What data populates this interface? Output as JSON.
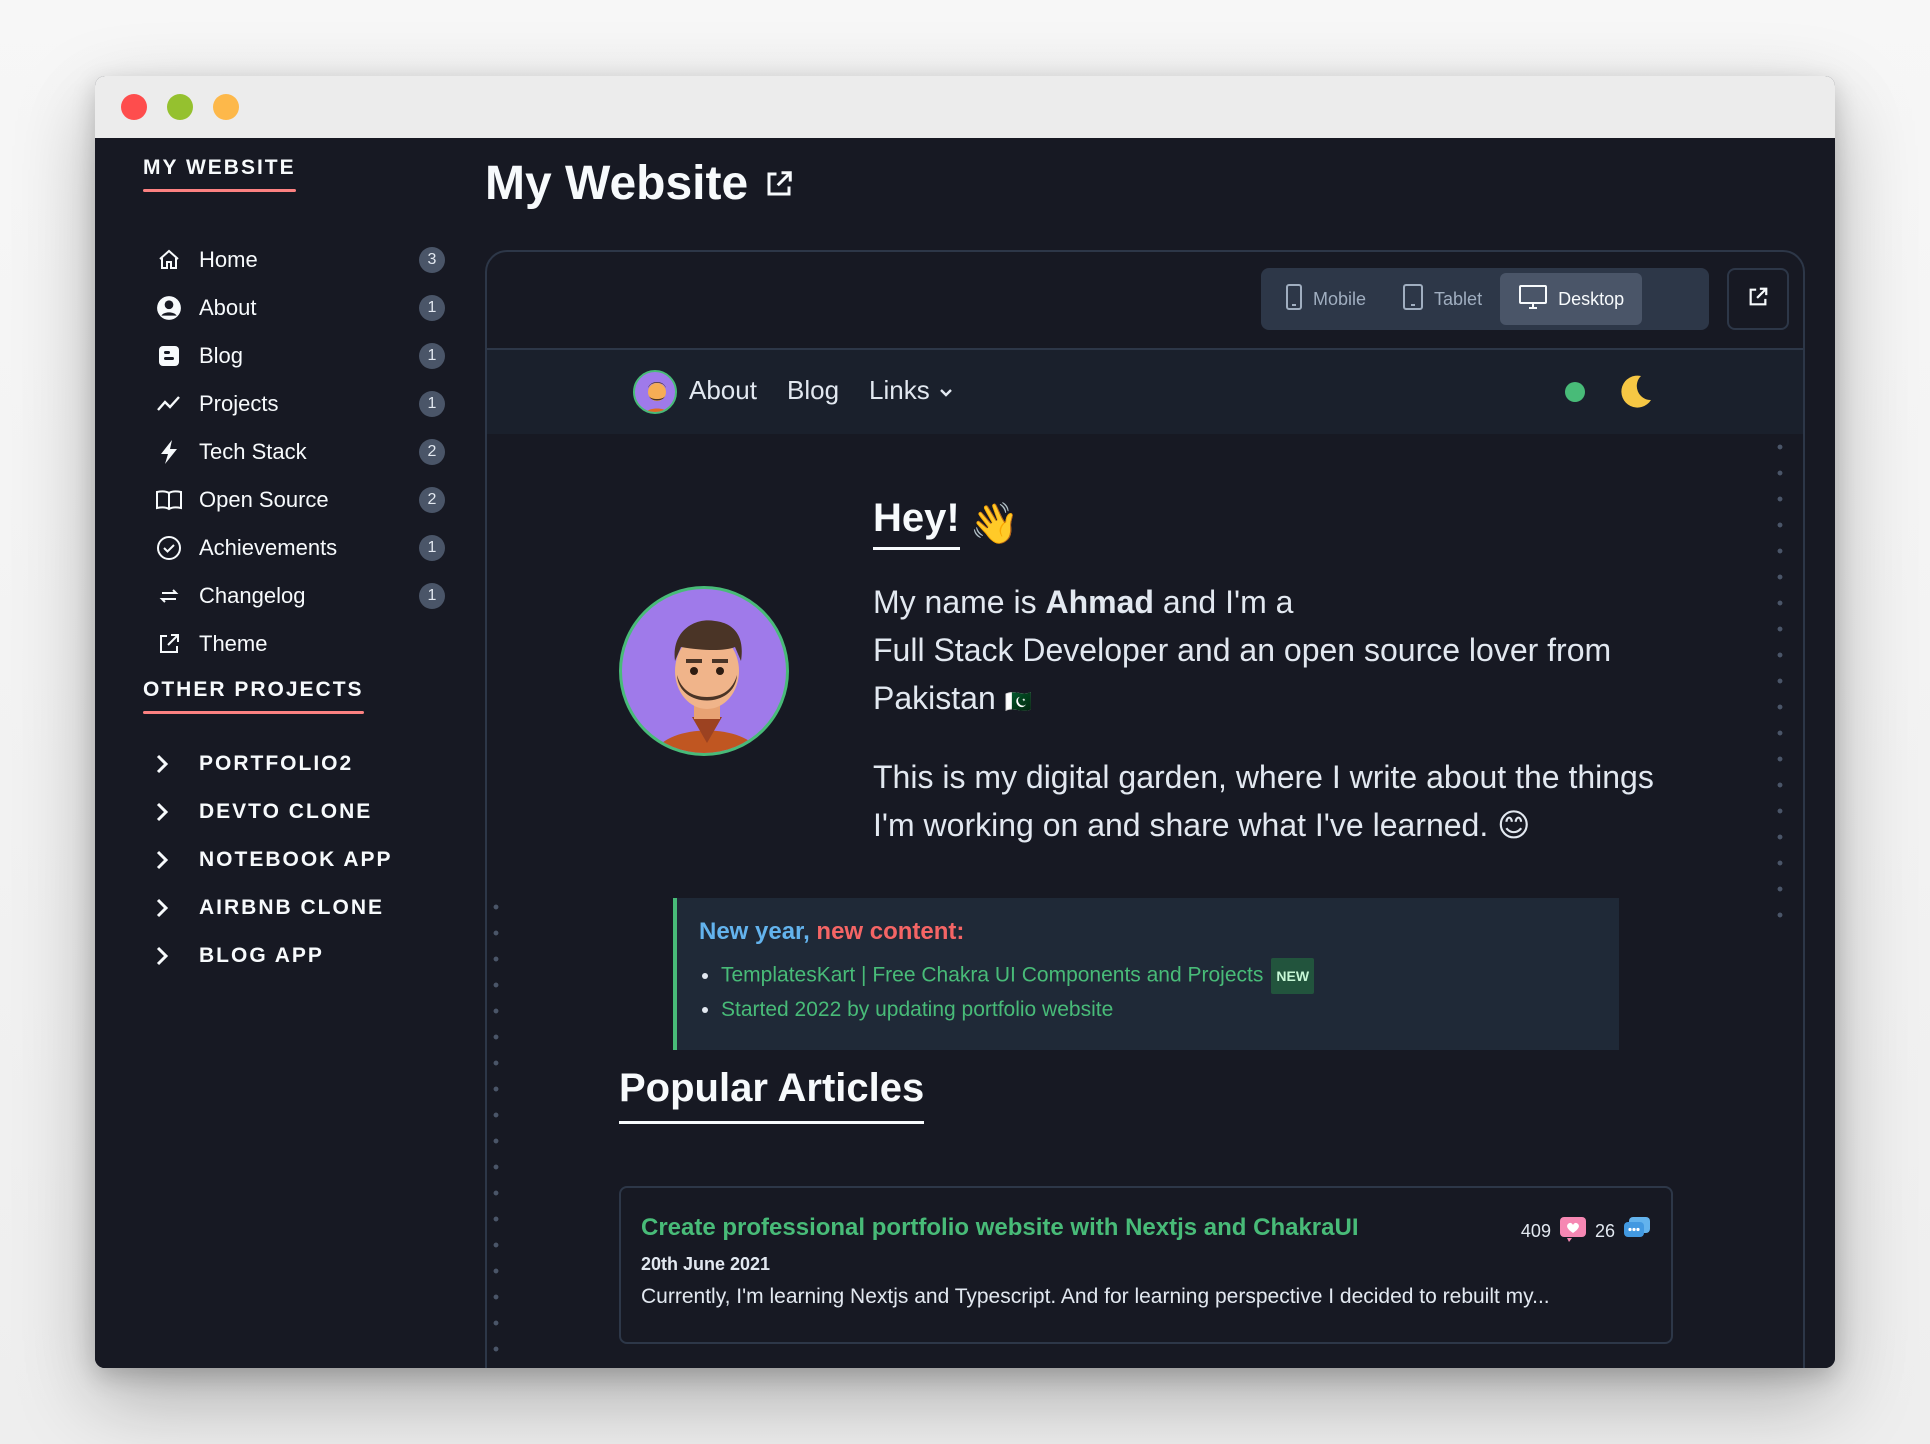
{
  "window": {
    "controls": [
      "close",
      "minimize",
      "maximize"
    ]
  },
  "colors": {
    "accent_green": "#48bb78",
    "underline_red": "#fc8181",
    "close": "#fe4d4d",
    "minimize": "#95c12f",
    "maximize": "#fdb84a"
  },
  "sidebar": {
    "title": "MY WEBSITE",
    "items": [
      {
        "label": "Home",
        "icon": "home-icon",
        "count": "3"
      },
      {
        "label": "About",
        "icon": "user-circle-icon",
        "count": "1"
      },
      {
        "label": "Blog",
        "icon": "blogger-icon",
        "count": "1"
      },
      {
        "label": "Projects",
        "icon": "trend-line-icon",
        "count": "1"
      },
      {
        "label": "Tech Stack",
        "icon": "lightning-icon",
        "count": "2"
      },
      {
        "label": "Open Source",
        "icon": "book-open-icon",
        "count": "2"
      },
      {
        "label": "Achievements",
        "icon": "check-circle-icon",
        "count": "1"
      },
      {
        "label": "Changelog",
        "icon": "arrows-swap-icon",
        "count": "1"
      },
      {
        "label": "Theme",
        "icon": "external-link-icon",
        "count": ""
      }
    ],
    "other_title": "OTHER PROJECTS",
    "other_projects": [
      "PORTFOLIO2",
      "DEVTO CLONE",
      "NOTEBOOK APP",
      "AIRBNB CLONE",
      "BLOG APP"
    ]
  },
  "main": {
    "title": "My Website",
    "devices": [
      {
        "label": "Mobile",
        "icon": "phone-icon",
        "active": false
      },
      {
        "label": "Tablet",
        "icon": "tablet-icon",
        "active": false
      },
      {
        "label": "Desktop",
        "icon": "monitor-icon",
        "active": true
      }
    ]
  },
  "preview": {
    "nav": {
      "about": "About",
      "blog": "Blog",
      "links": "Links"
    },
    "hey": "Hey!",
    "wave": "👋",
    "intro": {
      "p1_pre": "My name is ",
      "name": "Ahmad",
      "p1_mid": " and I'm a",
      "p1_rest": "Full Stack Developer and an open source lover from Pakistan",
      "flag": "🇵🇰",
      "p2": "This is my digital garden, where I write about the things I'm working on and share what I've learned.",
      "smile": "😊"
    },
    "callout": {
      "title_a": "New year,",
      "title_b": " new content:",
      "items": [
        {
          "text": "TemplatesKart | Free Chakra UI Components and Projects",
          "tag": "NEW"
        },
        {
          "text": "Started 2022 by updating portfolio website",
          "tag": ""
        }
      ]
    },
    "popular_title": "Popular Articles",
    "article": {
      "title": "Create professional portfolio website with Nextjs and ChakraUI",
      "date": "20th June 2021",
      "excerpt": "Currently, I'm learning Nextjs and Typescript. And for learning perspective I decided to rebuilt my...",
      "likes": "409",
      "comments": "26"
    }
  }
}
